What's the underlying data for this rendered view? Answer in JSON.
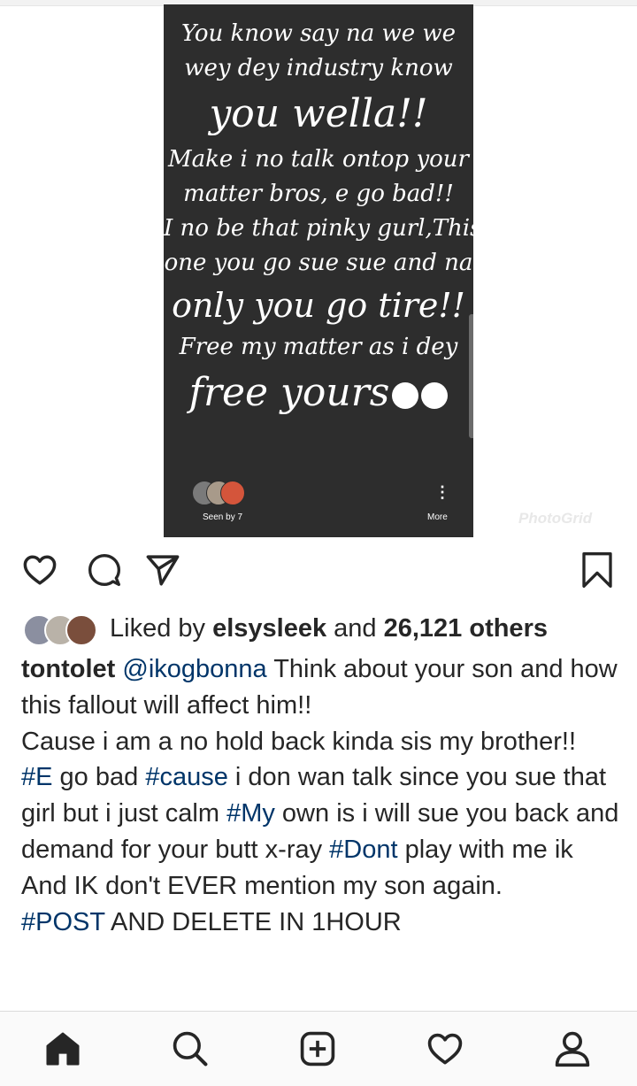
{
  "story": {
    "lines": [
      "You know say na we we",
      "wey dey industry know",
      "you wella!!",
      "Make i no talk ontop your",
      "matter bros, e go bad!!",
      "I no be that pinky gurl,This",
      "one you go sue sue and na",
      "only you go tire!!",
      "Free my matter as i dey",
      "free yours"
    ],
    "seen_by": "Seen by 7",
    "more_label": "More"
  },
  "watermark": "PhotoGrid",
  "icons": {
    "like": "heart-icon",
    "comment": "comment-icon",
    "share": "paper-plane-icon",
    "save": "bookmark-icon",
    "home": "home-icon",
    "search": "search-icon",
    "new_post": "plus-square-icon",
    "activity": "heart-icon",
    "profile": "person-icon"
  },
  "likes": {
    "prefix": "Liked by ",
    "user": "elsysleek",
    "middle": " and ",
    "count": "26,121 others"
  },
  "caption": {
    "username": "tontolet",
    "mention": "@ikogbonna",
    "p1_text": " Think about your son and how this fallout will affect him!!",
    "p2": "Cause i am a no hold back kinda sis my brother!!",
    "tag1": "#E",
    "t1": " go bad ",
    "tag2": "#cause",
    "t2": " i don wan talk since you sue that girl but i just calm ",
    "tag3": "#My",
    "t3": " own is i will sue you back and demand for your butt x-ray ",
    "tag4": "#Dont",
    "t4": " play with me ik",
    "p4": "And IK don't EVER mention my son again.",
    "tag5": "#POST",
    "t5": " AND DELETE IN 1HOUR"
  },
  "colors": {
    "story_bg": "#2d2d2d",
    "hashtag": "#003569",
    "text": "#262626"
  }
}
